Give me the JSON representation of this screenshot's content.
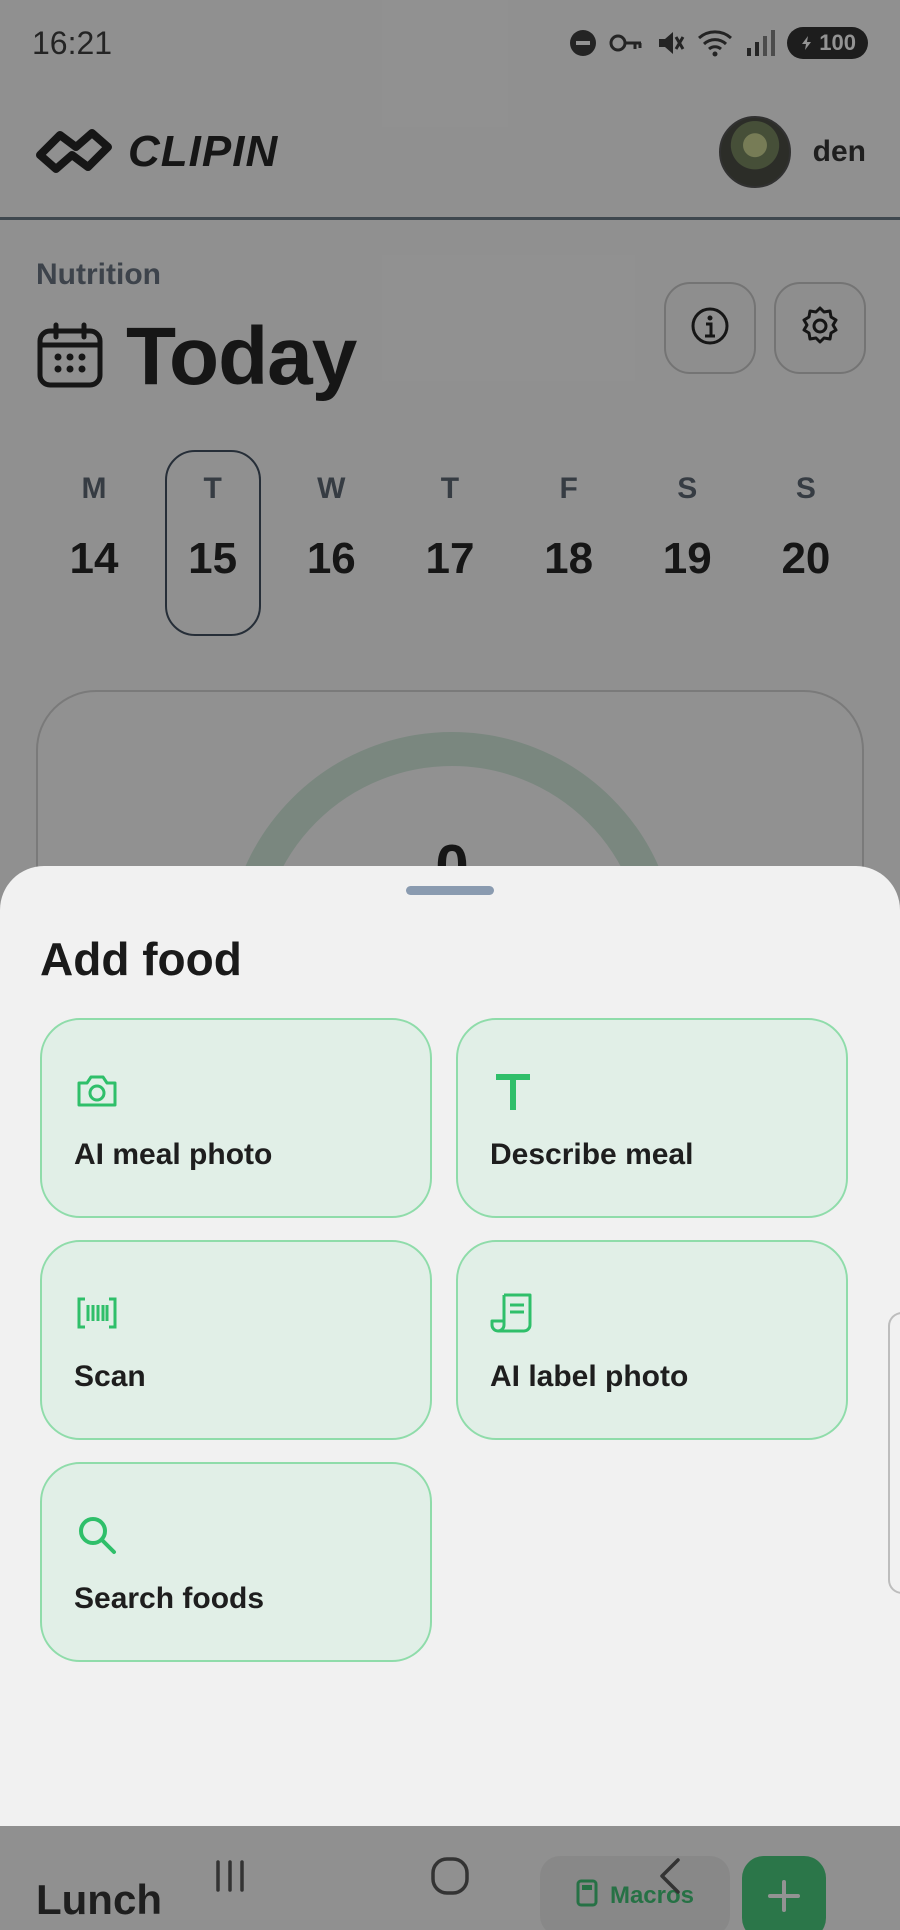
{
  "status_bar": {
    "time": "16:21",
    "battery": "100",
    "icons": [
      "do-not-disturb-icon",
      "vpn-key-icon",
      "mute-icon",
      "wifi-icon",
      "signal-icon",
      "battery-icon"
    ]
  },
  "header": {
    "logo_text": "CLIPIN",
    "user_name": "den"
  },
  "page": {
    "section_label": "Nutrition",
    "title": "Today",
    "info_icon": "info-icon",
    "settings_icon": "gear-icon"
  },
  "week": [
    {
      "letter": "M",
      "num": "14",
      "selected": false
    },
    {
      "letter": "T",
      "num": "15",
      "selected": true
    },
    {
      "letter": "W",
      "num": "16",
      "selected": false
    },
    {
      "letter": "T",
      "num": "17",
      "selected": false
    },
    {
      "letter": "F",
      "num": "18",
      "selected": false
    },
    {
      "letter": "S",
      "num": "19",
      "selected": false
    },
    {
      "letter": "S",
      "num": "20",
      "selected": false
    }
  ],
  "summary": {
    "calories_value": "0"
  },
  "bottom": {
    "meal_label": "Lunch",
    "macros_label": "Macros"
  },
  "sheet": {
    "title": "Add food",
    "options": [
      {
        "label": "AI meal photo",
        "icon": "camera-icon"
      },
      {
        "label": "Describe meal",
        "icon": "text-icon"
      },
      {
        "label": "Scan",
        "icon": "barcode-icon"
      },
      {
        "label": "AI label photo",
        "icon": "receipt-icon"
      },
      {
        "label": "Search foods",
        "icon": "search-icon"
      }
    ]
  },
  "colors": {
    "accent": "#2fbf6a",
    "option_bg": "#e1efe7",
    "option_border": "#8fdcaa",
    "sheet_bg": "#f1f1f1"
  }
}
